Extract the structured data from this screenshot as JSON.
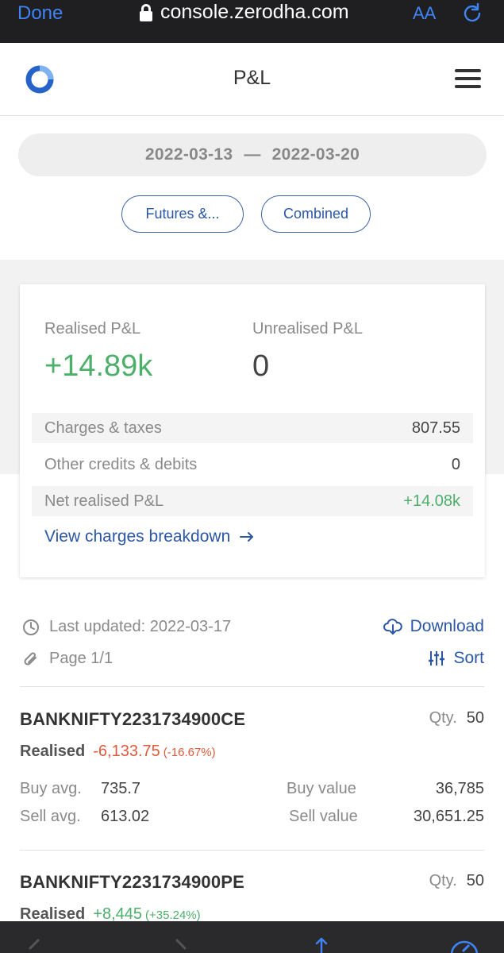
{
  "browser": {
    "done_label": "Done",
    "url": "console.zerodha.com",
    "text_size_label": "AA"
  },
  "header": {
    "title": "P&L"
  },
  "filters": {
    "date_from": "2022-03-13",
    "date_separator": "—",
    "date_to": "2022-03-20",
    "segment_label": "Futures &...",
    "combined_label": "Combined"
  },
  "summary": {
    "realised_label": "Realised P&L",
    "realised_value": "+14.89k",
    "unrealised_label": "Unrealised P&L",
    "unrealised_value": "0",
    "charges_label": "Charges & taxes",
    "charges_value": "807.55",
    "other_label": "Other credits & debits",
    "other_value": "0",
    "net_label": "Net realised P&L",
    "net_value": "+14.08k",
    "breakdown_link": "View charges breakdown"
  },
  "meta": {
    "last_updated": "Last updated: 2022-03-17",
    "page": "Page 1/1",
    "download_label": "Download",
    "sort_label": "Sort"
  },
  "positions": [
    {
      "symbol": "BANKNIFTY2231734900CE",
      "qty_label": "Qty.",
      "qty": "50",
      "realised_label": "Realised",
      "realised_value": "-6,133.75",
      "realised_pct": "(-16.67%)",
      "buy_avg_label": "Buy avg.",
      "buy_avg": "735.7",
      "sell_avg_label": "Sell avg.",
      "sell_avg": "613.02",
      "buy_value_label": "Buy value",
      "buy_value": "36,785",
      "sell_value_label": "Sell value",
      "sell_value": "30,651.25"
    },
    {
      "symbol": "BANKNIFTY2231734900PE",
      "qty_label": "Qty.",
      "qty": "50",
      "realised_label": "Realised",
      "realised_value": "+8,445",
      "realised_pct": "(+35.24%)"
    }
  ],
  "colors": {
    "accent": "#2b57a6",
    "profit": "#4caf6a",
    "loss": "#e05a3c"
  }
}
